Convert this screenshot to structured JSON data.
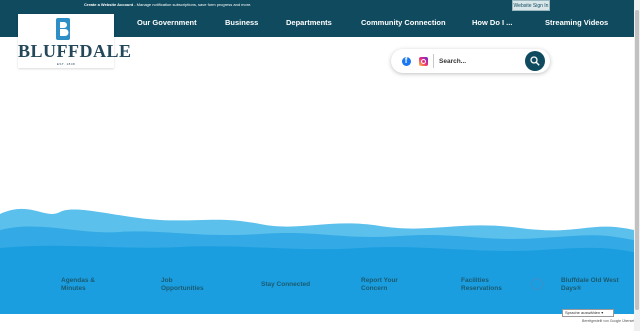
{
  "topbar": {
    "note_bold": "Create a Website Account",
    "note_rest": " - Manage notification subscriptions, save form progress and more.",
    "sign_in": "Website Sign In",
    "color": "#0f4a5e"
  },
  "logo": {
    "name": "BLUFFDALE",
    "est": "EST. 1848",
    "icon": "logo-b-icon"
  },
  "nav": {
    "items": [
      "Our Government",
      "Business",
      "Departments",
      "Community Connection",
      "How Do I ...",
      "Streaming Videos"
    ]
  },
  "search": {
    "placeholder": "Search...",
    "icons": [
      "facebook-icon",
      "instagram-icon",
      "search-icon"
    ]
  },
  "quick_links": [
    "Agendas &\nMinutes",
    "Job\nOpportunities",
    "Stay Connected",
    "Report Your\nConcern",
    "Facilities\nReservations",
    "Bluffdale Old West\nDays®"
  ],
  "translate": {
    "label": "Sprache auswählen ▾",
    "powered": "Bereitgestellt von Google Übersetzer"
  },
  "colors": {
    "mountain_back": "#5cc0ec",
    "mountain_mid": "#2fa6e3",
    "mountain_front": "#1b9ee0"
  }
}
